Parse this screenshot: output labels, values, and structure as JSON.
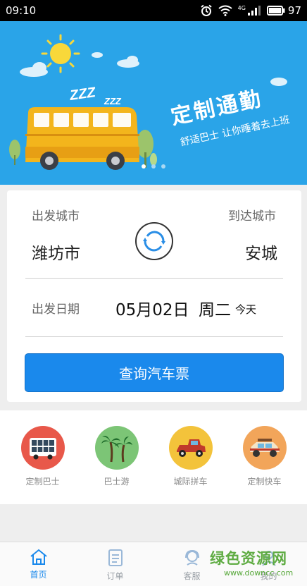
{
  "status_bar": {
    "time": "09:10",
    "network": "4G",
    "battery": "97"
  },
  "banner": {
    "title": "定制通勤",
    "subtitle": "舒适巴士 让你睡着去上班",
    "zzz_big": "ZZZ",
    "zzz_small": "ZZZ"
  },
  "search": {
    "origin_label": "出发城市",
    "origin_city": "潍坊市",
    "dest_label": "到达城市",
    "dest_city": "安城",
    "date_label": "出发日期",
    "date_value": "05月02日",
    "weekday": "周二",
    "today": "今天",
    "button_label": "查询汽车票"
  },
  "services": [
    {
      "label": "定制巴士",
      "color": "#e8584a"
    },
    {
      "label": "巴士游",
      "color": "#7cc576"
    },
    {
      "label": "城际拼车",
      "color": "#f3c33b"
    },
    {
      "label": "定制快车",
      "color": "#f2a55a"
    }
  ],
  "tabbar": [
    {
      "label": "首页",
      "active": true
    },
    {
      "label": "订单",
      "active": false
    },
    {
      "label": "客服",
      "active": false
    },
    {
      "label": "我的",
      "active": false
    }
  ],
  "watermark": {
    "text": "绿色资源网",
    "url": "www.downcc.com"
  }
}
